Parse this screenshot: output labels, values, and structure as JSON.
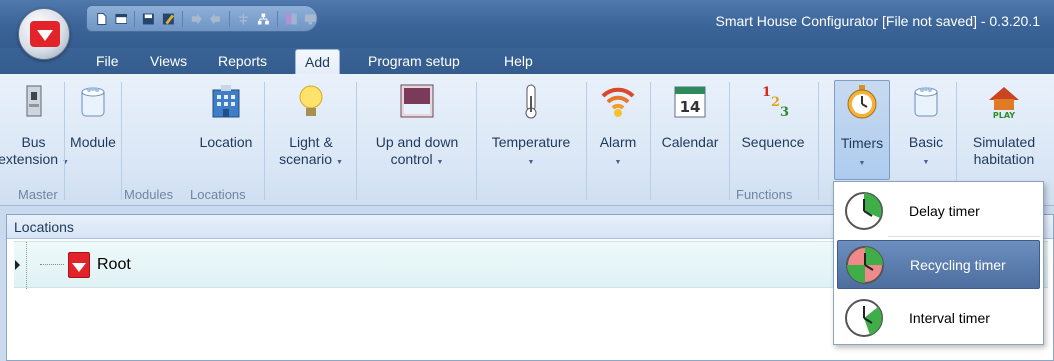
{
  "window": {
    "title": "Smart House Configurator [File not saved] - 0.3.20.1"
  },
  "menu": {
    "items": [
      "File",
      "Views",
      "Reports",
      "Add",
      "Program setup",
      "Help"
    ],
    "active": "Add"
  },
  "ribbon": {
    "buttons": [
      {
        "id": "bus-extension",
        "line1": "Bus",
        "line2": "extension",
        "has_dropdown": true,
        "icon": "bus-extension-icon"
      },
      {
        "id": "module",
        "line1": "Module",
        "line2": "",
        "has_dropdown": false,
        "icon": "module-icon"
      },
      {
        "id": "location",
        "line1": "Location",
        "line2": "",
        "has_dropdown": false,
        "icon": "building-icon"
      },
      {
        "id": "light-scenario",
        "line1": "Light &",
        "line2": "scenario",
        "has_dropdown": true,
        "icon": "light-bulb-icon"
      },
      {
        "id": "up-down-control",
        "line1": "Up and down",
        "line2": "control",
        "has_dropdown": true,
        "icon": "blind-icon"
      },
      {
        "id": "temperature",
        "line1": "Temperature",
        "line2": "",
        "has_dropdown": true,
        "icon": "thermometer-icon"
      },
      {
        "id": "alarm",
        "line1": "Alarm",
        "line2": "",
        "has_dropdown": true,
        "icon": "alarm-icon"
      },
      {
        "id": "calendar",
        "line1": "Calendar",
        "line2": "",
        "has_dropdown": false,
        "icon": "calendar-icon",
        "icon_text": "14"
      },
      {
        "id": "sequence",
        "line1": "Sequence",
        "line2": "",
        "has_dropdown": false,
        "icon": "sequence-icon",
        "icon_text": [
          "1",
          "2",
          "3"
        ]
      },
      {
        "id": "timers",
        "line1": "Timers",
        "line2": "",
        "has_dropdown": true,
        "icon": "stopwatch-icon",
        "pressed": true
      },
      {
        "id": "basic",
        "line1": "Basic",
        "line2": "",
        "has_dropdown": true,
        "icon": "basic-module-icon"
      },
      {
        "id": "simulated-habitation",
        "line1": "Simulated",
        "line2": "habitation",
        "has_dropdown": false,
        "icon": "house-play-icon",
        "icon_text": "PLAY"
      }
    ],
    "groups": [
      "Master",
      "Modules",
      "Locations",
      "Functions"
    ]
  },
  "locations_panel": {
    "title": "Locations",
    "root_label": "Root"
  },
  "timers_menu": {
    "items": [
      {
        "label": "Delay timer",
        "icon": "delay-timer-icon",
        "active": false
      },
      {
        "label": "Recycling timer",
        "icon": "recycling-timer-icon",
        "active": true
      },
      {
        "label": "Interval timer",
        "icon": "interval-timer-icon",
        "active": false
      }
    ]
  },
  "colors": {
    "titlebar": "#3b6498",
    "ribbon": "#dce8f6",
    "accent_red": "#e3232a",
    "menu_active": "#4d6e9f"
  }
}
